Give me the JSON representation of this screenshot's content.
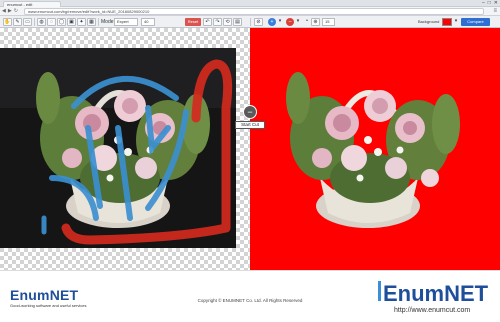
{
  "browser": {
    "tab_title": "enumcut - edit",
    "url": "www.enumcut.com/bg/remove/edit?work_id=NUE_20160829000210",
    "window_controls": [
      "–",
      "□",
      "✕"
    ],
    "nav_icons": [
      "back-icon",
      "forward-icon",
      "reload-icon"
    ]
  },
  "toolbar": {
    "mode_label": "Mode:",
    "mode_value": "Expert",
    "brush_size_value": "40",
    "reset_label": "Reset",
    "zoom_value": "15",
    "background_label": "Background",
    "background_color": "#ff0000",
    "compare_label": "Compare",
    "icons": [
      "hand-icon",
      "brush-icon",
      "eraser-icon",
      "undo-icon",
      "redo-icon",
      "zoom-icon",
      "plus-icon",
      "minus-icon"
    ]
  },
  "workarea": {
    "start_cut_label": "Start Cut",
    "right_background": "#ff0000",
    "keep_stroke_color": "#3b8fd0",
    "remove_stroke_color": "#d42a1e"
  },
  "footer": {
    "logo_left": "EnumNET",
    "tagline": "Good-working software and useful services",
    "copyright": "Copyright © ENUMNET Co. Ltd. All Rights Reserved",
    "logo_right": "EnumNET",
    "site_url": "http://www.enumcut.com"
  }
}
